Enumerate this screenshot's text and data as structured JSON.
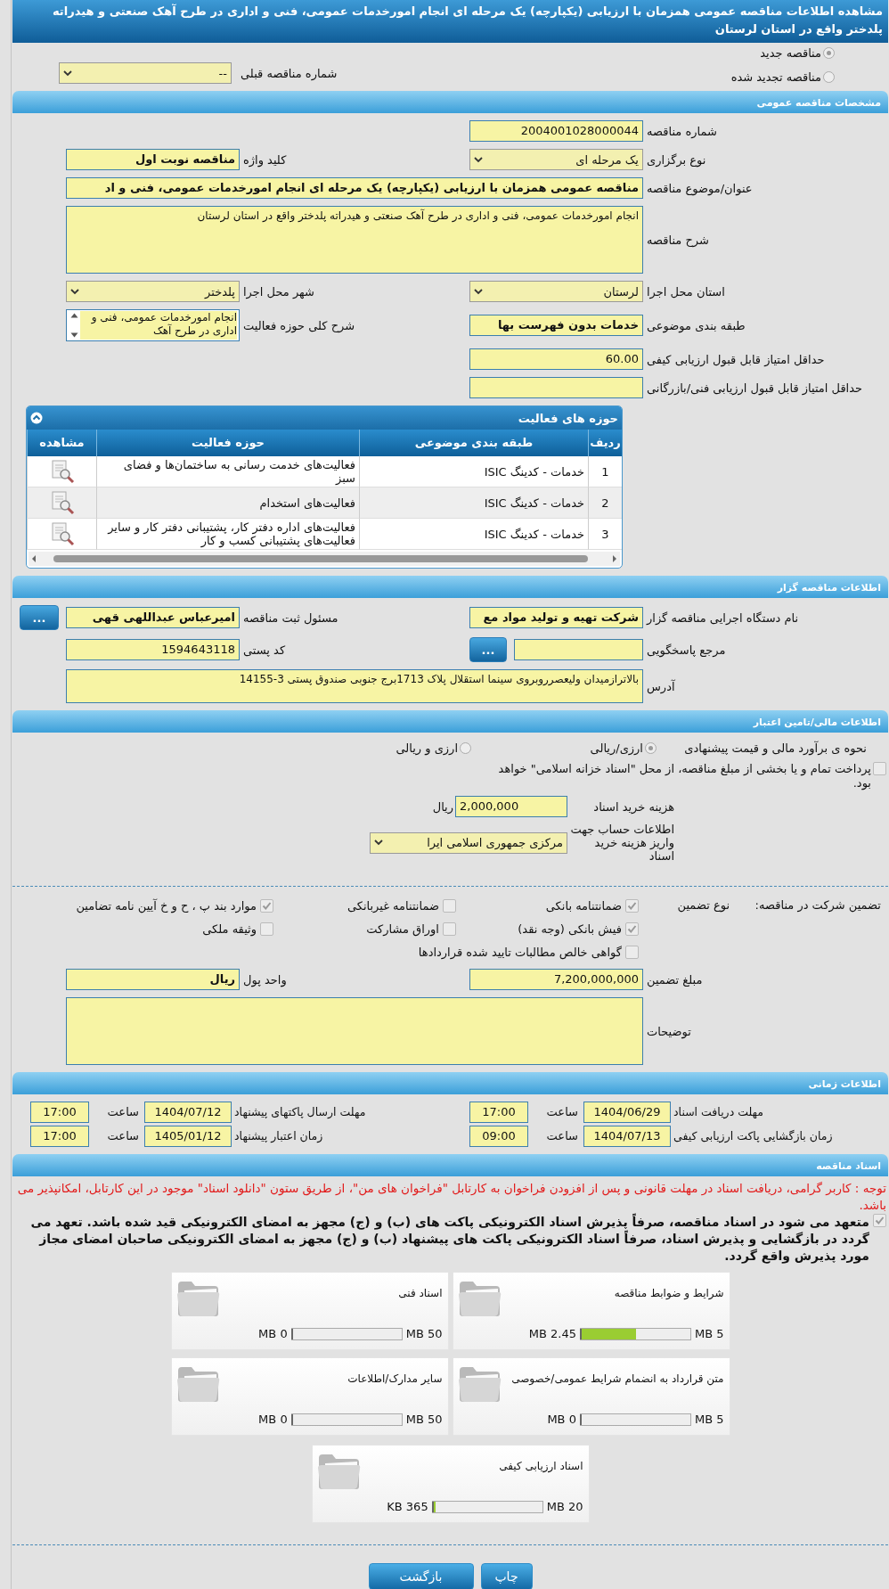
{
  "title": "مشاهده اطلاعات مناقصه عمومی همزمان با ارزیابی (یکپارچه) یک مرحله ای انجام امورخدمات عمومی، فنی و اداری در طرح آهک صنعتی و هیدراته پلدختر واقع در استان لرستان",
  "tender_kind": [
    {
      "label": "مناقصه جدید",
      "selected": true
    },
    {
      "label": "مناقصه تجدید شده",
      "selected": false
    }
  ],
  "previous_tender": {
    "label": "شماره مناقصه قبلی",
    "value": "--"
  },
  "general": {
    "heading": "مشخصات مناقصه عمومی",
    "rows": [
      {
        "right": {
          "label": "شماره مناقصه",
          "kind": "input",
          "value": "2004001028000044"
        }
      },
      {
        "right": {
          "label": "نوع برگزاری",
          "kind": "select",
          "value": "یک مرحله ای"
        },
        "left": {
          "label": "کلید واژه",
          "kind": "input",
          "value": "مناقصه نوبت اول",
          "bold": true
        }
      },
      {
        "right": {
          "label": "عنوان/موضوع مناقصه",
          "kind": "input",
          "wide": true,
          "bold": true,
          "value": "مناقصه عمومی همزمان با ارزیابی (یکپارچه) یک مرحله ای انجام امورخدمات عمومی، فنی و  اد"
        }
      },
      {
        "right": {
          "label": "شرح مناقصه",
          "kind": "textarea",
          "wide": true,
          "value": "انجام امورخدمات عمومی، فنی و  اداری در طرح آهک صنعتی و هیدراته پلدختر واقع در استان لرستان"
        }
      },
      {
        "right": {
          "label": "استان محل اجرا",
          "kind": "select",
          "value": "لرستان"
        },
        "left": {
          "label": "شهر محل اجرا",
          "kind": "select",
          "value": "پلدختر"
        }
      },
      {
        "right": {
          "label": "طبقه بندی موضوعی",
          "kind": "input",
          "value": "خدمات بدون فهرست بها",
          "bold": true
        },
        "left": {
          "label": "شرح کلی حوزه فعالیت",
          "kind": "scroll",
          "value": "انجام امورخدمات عمومی، فنی و  اداری در طرح آهک"
        }
      },
      {
        "right": {
          "label": "حداقل امتیاز قابل قبول ارزیابی کیفی",
          "kind": "input",
          "value": "60.00"
        }
      },
      {
        "right": {
          "label": "حداقل امتیاز قابل قبول ارزیابی فنی/بازرگانی",
          "kind": "input"
        }
      }
    ]
  },
  "activities": {
    "heading": "حوزه های فعالیت",
    "columns": [
      "ردیف",
      "طبقه بندی موضوعی",
      "حوزه فعالیت",
      "مشاهده"
    ],
    "rows": [
      {
        "index": "1",
        "category": "خدمات - کدینگ ISIC",
        "activity": "فعالیت‌های خدمت رسانی به ساختمان‌ها و فضای سبز"
      },
      {
        "index": "2",
        "category": "خدمات - کدینگ ISIC",
        "activity": "فعالیت‌های استخدام"
      },
      {
        "index": "3",
        "category": "خدمات - کدینگ ISIC",
        "activity": "فعالیت‌های  اداره دفتر کار، پشتیبانی دفتر کار و سایر  فعالیت‌های پشتیبانی کسب و کار"
      }
    ]
  },
  "organizer": {
    "heading": "اطلاعات مناقصه گزار",
    "rows": [
      {
        "right": {
          "label": "نام دستگاه اجرایی مناقصه گزار",
          "kind": "input",
          "value": "شرکت تهیه و تولید مواد مع",
          "bold": true
        },
        "left": {
          "label": "مسئول ثبت مناقصه",
          "kind": "input",
          "value": "امیرعباس عبداللهی قهی",
          "bold": true,
          "button": "..."
        }
      },
      {
        "right": {
          "label": "مرجع پاسخگویی",
          "kind": "input",
          "button": "..."
        },
        "left": {
          "label": "کد پستی",
          "kind": "input",
          "value": "1594643118"
        }
      },
      {
        "right": {
          "label": "آدرس",
          "kind": "textline",
          "wide": true,
          "value": "بالاترازمیدان ولیعصرروبروی سینما استقلال پلاک 1713برج جنوبی صندوق پستی 3-14155"
        }
      }
    ]
  },
  "finance": {
    "heading": "اطلاعات مالی/تامین اعتبار",
    "estimate": {
      "label": "نحوه ی برآورد مالی و قیمت پیشنهادی",
      "options": [
        {
          "label": "ارزی/ریالی",
          "selected": true
        },
        {
          "label": "ارزی و ریالی",
          "selected": false
        }
      ]
    },
    "treasury": {
      "label": "پرداخت تمام و یا بخشی از مبلغ مناقصه، از محل \"اسناد خزانه اسلامی\" خواهد بود.",
      "checked": false
    },
    "document_fee": {
      "label": "هزینه خرید اسناد",
      "value": "2,000,000",
      "unit": "ریال"
    },
    "account": {
      "label": "اطلاعات حساب جهت واریز هزینه خرید اسناد",
      "value": "مرکزی جمهوری اسلامی ایرا"
    }
  },
  "guarantee": {
    "label": "تضمین شرکت در مناقصه:",
    "type_label": "نوع تضمین",
    "options": [
      {
        "label": "ضمانتنامه بانکی",
        "checked": true
      },
      {
        "label": "ضمانتنامه غیربانکی",
        "checked": false
      },
      {
        "label": "موارد بند پ ، ح و خ آیین نامه تضامین",
        "checked": true
      },
      {
        "label": "فیش بانکی (وجه نقد)",
        "checked": true
      },
      {
        "label": "اوراق مشارکت",
        "checked": false
      },
      {
        "label": "وثیقه ملکی",
        "checked": false
      },
      {
        "label": "گواهی خالص مطالبات تایید شده قراردادها",
        "checked": false
      }
    ],
    "rows": [
      {
        "right": {
          "label": "مبلغ تضمین",
          "kind": "input",
          "value": "7,200,000,000"
        },
        "left": {
          "label": "واحد پول",
          "kind": "input",
          "value": "ریال",
          "bold": true
        }
      },
      {
        "right": {
          "label": "توضیحات",
          "kind": "textarea",
          "wide": true
        }
      }
    ]
  },
  "schedule": {
    "heading": "اطلاعات زمانی",
    "items": [
      {
        "label": "مهلت دریافت اسناد",
        "date": "1404/06/29",
        "time_label": "ساعت",
        "time": "17:00"
      },
      {
        "label": "مهلت ارسال پاکتهای پیشنهاد",
        "date": "1404/07/12",
        "time_label": "ساعت",
        "time": "17:00"
      },
      {
        "label": "زمان بازگشایی پاکت ارزیابی کیفی",
        "date": "1404/07/13",
        "time_label": "ساعت",
        "time": "09:00"
      },
      {
        "label": "زمان اعتبار پیشنهاد",
        "date": "1405/01/12",
        "time_label": "ساعت",
        "time": "17:00"
      }
    ]
  },
  "documents": {
    "heading": "اسناد مناقصه",
    "notice": "توجه : کاربر گرامی، دریافت اسناد در مهلت قانونی و پس از افزودن فراخوان به کارتابل \"فراخوان های من\"، از طریق ستون \"دانلود اسناد\" موجود در این کارتابل، امکانپذیر می باشد.",
    "commitment": {
      "text": "متعهد می شود در اسناد مناقصه، صرفاً پذیرش اسناد الکترونیکی پاکت های (ب) و (ج) مجهز به امضای الکترونیکی قید شده باشد. تعهد می گردد در بازگشایی و پذیرش اسناد، صرفاً اسناد الکترونیکی پاکت های پیشنهاد (ب) و (ج) مجهز به امضای الکترونیکی صاحبان امضای مجاز مورد پذیرش واقع گردد.",
      "checked": true
    },
    "files": [
      {
        "name": "شرایط و ضوابط مناقصه",
        "used": "2.45 MB",
        "limit": "5 MB",
        "level": 0.49
      },
      {
        "name": "اسناد فنی",
        "used": "0 MB",
        "limit": "50 MB",
        "level": 0
      },
      {
        "name": "متن قرارداد به انضمام شرایط عمومی/خصوصی",
        "used": "0 MB",
        "limit": "5 MB",
        "level": 0
      },
      {
        "name": "سایر مدارک/اطلاعات",
        "used": "0 MB",
        "limit": "50 MB",
        "level": 0
      },
      {
        "name": "اسناد ارزیابی کیفی",
        "used": "365 KB",
        "limit": "20 MB",
        "level": 0.018
      }
    ]
  },
  "buttons": [
    "چاپ",
    "بازگشت"
  ]
}
